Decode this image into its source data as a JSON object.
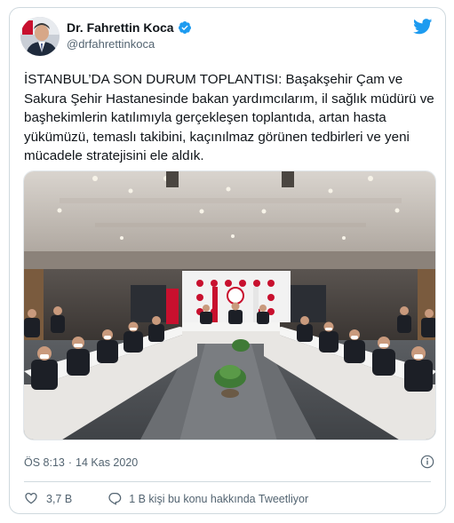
{
  "author": {
    "display_name": "Dr. Fahrettin Koca",
    "handle": "@drfahrettinkoca",
    "verified": true
  },
  "tweet": {
    "text": "İSTANBUL’DA SON DURUM TOPLANTISI: Başakşehir Çam ve Sakura Şehir Hastanesinde bakan yardımcılarım, il sağlık müdürü ve başhekimlerin katılımıyla gerçekleşen toplantıda, artan hasta yükümüzü, temaslı takibini, kaçınılmaz görünen tedbirleri ve yeni mücadele stratejisini ele aldık.",
    "time": "ÖS 8:13",
    "date": "14 Kas 2020",
    "separator": "·"
  },
  "actions": {
    "like_count": "3,7 B",
    "reply_text": "1 B kişi bu konu hakkında Tweetliyor"
  },
  "icons": {
    "brand": "twitter-bird-icon",
    "verified": "verified-badge-icon",
    "info": "info-icon",
    "like": "heart-icon",
    "reply": "reply-bubble-icon"
  },
  "colors": {
    "twitter_blue": "#1d9bf0",
    "text_primary": "#0f1419",
    "text_secondary": "#536471",
    "border": "#cfd9de"
  }
}
